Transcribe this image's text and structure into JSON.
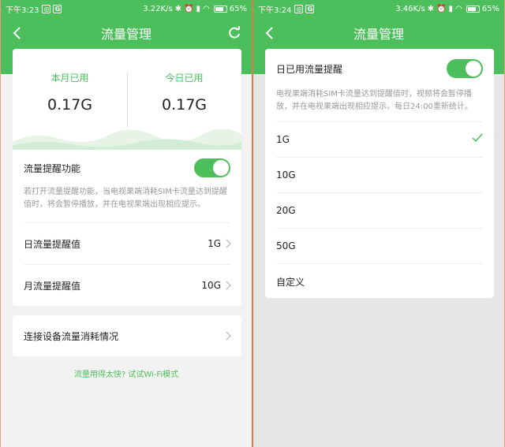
{
  "left": {
    "status": {
      "time": "下午3:23",
      "badge1": "◎",
      "badge2": "G",
      "speed": "3.22K/s",
      "battery": "65%"
    },
    "title": "流量管理",
    "usage": {
      "month_label": "本月已用",
      "month_value": "0.17G",
      "today_label": "今日已用",
      "today_value": "0.17G"
    },
    "alert": {
      "label": "流量提醒功能",
      "desc": "若打开流量提醒功能，当电视果端消耗SIM卡流量达到提醒值时，将会暂停播放，并在电视果端出现相应提示。",
      "daily_label": "日流量提醒值",
      "daily_value": "1G",
      "monthly_label": "月流量提醒值",
      "monthly_value": "10G"
    },
    "device_label": "连接设备流量消耗情况",
    "tip": "流量用得太快? 试试Wi-Fi模式"
  },
  "right": {
    "status": {
      "time": "下午3:24",
      "badge1": "◎",
      "badge2": "G",
      "speed": "3.46K/s",
      "battery": "65%"
    },
    "title": "流量管理",
    "dialog": {
      "label": "日已用流量提醒",
      "desc": "电视果端消耗SIM卡流量达到提醒值时，视频将会暂停播放，并在电视果端出现相应提示。每日24:00重新统计。",
      "options": [
        "1G",
        "10G",
        "20G",
        "50G",
        "自定义"
      ],
      "selected": "1G"
    }
  },
  "colors": {
    "accent": "#4cbf5c",
    "frame": "#e07b4a"
  },
  "battery_level": 0.65
}
